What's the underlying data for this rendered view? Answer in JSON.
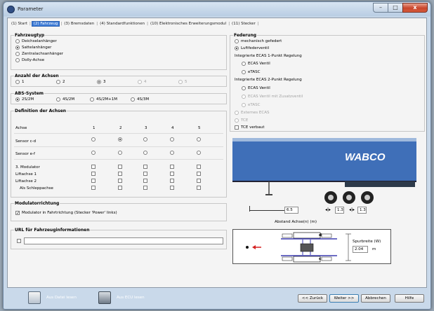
{
  "window": {
    "title": "Parameter",
    "controls": {
      "minimize": "–",
      "maximize": "□",
      "close": "x"
    }
  },
  "tabs": [
    {
      "label": "(1) Start"
    },
    {
      "label": "(2) Fahrzeug"
    },
    {
      "label": "(3) Bremsdaten"
    },
    {
      "label": "(4) Standardfunktionen"
    },
    {
      "label": "(10) Elektronisches Erweiterungsmodul"
    },
    {
      "label": "(11) Stecker"
    }
  ],
  "fahrzeugtyp": {
    "title": "Fahrzeugtyp",
    "options": [
      "Deichselanhänger",
      "Sattelanhänger",
      "Zentralachsanhänger",
      "Dolly-Achse"
    ],
    "selected": "Sattelanhänger"
  },
  "anzahl_achsen": {
    "title": "Anzahl der Achsen",
    "options": [
      "1",
      "2",
      "3",
      "4",
      "5"
    ],
    "selected": "3"
  },
  "abs": {
    "title": "ABS-System",
    "options": [
      "2S/2M",
      "4S/2M",
      "4S/2M+1M",
      "4S/3M"
    ],
    "selected": "2S/2M"
  },
  "definition": {
    "title": "Definition der Achsen",
    "achse_label": "Achse",
    "columns": [
      "1",
      "2",
      "3",
      "4",
      "5"
    ],
    "rows": [
      {
        "label": "Sensor c-d",
        "type": "radio",
        "selected": "2"
      },
      {
        "label": "Sensor e-f",
        "type": "radio",
        "selected": ""
      },
      {
        "label": "3. Modulator",
        "type": "check"
      },
      {
        "label": "Liftachse 1",
        "type": "check"
      },
      {
        "label": "Liftachse 2",
        "type": "check"
      },
      {
        "label": "Als Schleppachse",
        "type": "check"
      }
    ]
  },
  "modulator": {
    "title": "Modulatorrichtung",
    "label": "Modulator in Fahrtrichtung (Stecker 'Power' links)",
    "checked": true
  },
  "url": {
    "title": "URL für Fahrzeuginformationen",
    "value": ""
  },
  "federung": {
    "title": "Federung",
    "mechanisch": "mechanisch gefedert",
    "luft": "Luftfederventil",
    "ecas1_title": "Integrierte ECAS 1-Punkt Regelung",
    "ecas1_options": [
      "ECAS Ventil",
      "eTASC"
    ],
    "ecas2_title": "Integrierte ECAS 2-Punkt Regelung",
    "ecas2_options": [
      "ECAS Ventil",
      "ECAS Ventil mit Zusatzventil",
      "eTASC"
    ],
    "extern": "Externes ECAS",
    "tce": "TCE",
    "tce_verbaut": "TCE verbaut"
  },
  "diagram": {
    "brand": "WABCO",
    "abstand_value": "6.5",
    "spacing1": "1.3",
    "spacing2": "1.3",
    "abstand_label": "Abstand Achse(n) (m)",
    "spurbreite_label": "Spurbreite (W)",
    "spurbreite_value": "2.04",
    "spurbreite_unit": "m",
    "sensor_top": "d",
    "sensor_bottom": "c",
    "colors": {
      "trailer": "#3f6fb8",
      "arrow": "#d42020",
      "axle": "#3b3bb0"
    }
  },
  "footer": {
    "aus_datei": "Aus Datei lesen",
    "aus_ecu": "Aus ECU lesen",
    "zurueck": "<< Zurück",
    "weiter": "Weiter >>",
    "abbrechen": "Abbrechen",
    "hilfe": "Hilfe"
  }
}
